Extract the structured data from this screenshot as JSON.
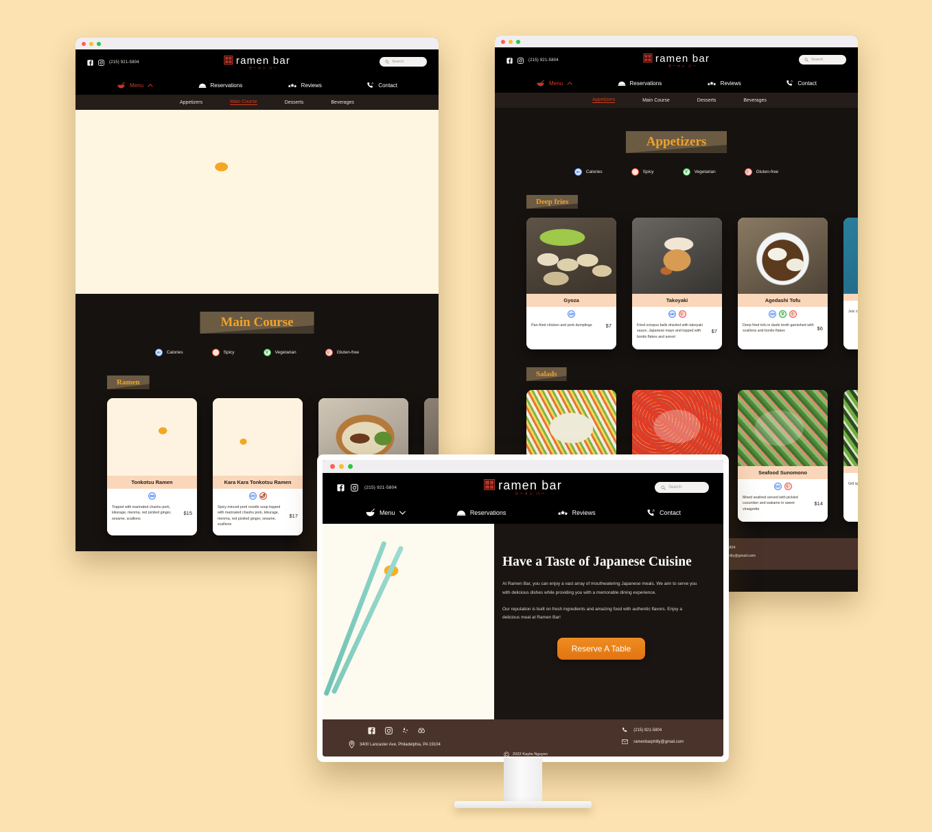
{
  "brand": {
    "name": "ramen bar",
    "kana": "ラーメン バー",
    "phone": "(215) 921-5804",
    "email": "ramenbarphilly@gmail.com",
    "address": "3400 Lancaster Ave, Philadelphia, PA 19104",
    "copyright": "2022 Kaylie Nguyen"
  },
  "colors": {
    "page_background": "#fbe2b0",
    "site_dark": "#000000",
    "body_dark": "#161210",
    "accent_red": "#d93b1d",
    "accent_gold": "#f0a22a",
    "banner_brown": "#6b5b44",
    "card_title_peach": "#fad7bb",
    "footer_brown": "#4a332a",
    "button_orange": "#ef8c21"
  },
  "search": {
    "placeholder": "Search",
    "value": ""
  },
  "nav": [
    {
      "label": "Menu",
      "icon": "ramen-bowl-icon",
      "active": true,
      "caret": "up"
    },
    {
      "label": "Reservations",
      "icon": "cloche-icon",
      "active": false
    },
    {
      "label": "Reviews",
      "icon": "stars-icon",
      "active": false
    },
    {
      "label": "Contact",
      "icon": "phone-ring-icon",
      "active": false
    }
  ],
  "nav_front": [
    {
      "label": "Menu",
      "icon": "ramen-bowl-icon",
      "active": false,
      "caret": "down"
    },
    {
      "label": "Reservations",
      "icon": "cloche-icon",
      "active": false
    },
    {
      "label": "Reviews",
      "icon": "stars-icon",
      "active": false
    },
    {
      "label": "Contact",
      "icon": "phone-ring-icon",
      "active": false
    }
  ],
  "subnav": [
    "Appetizers",
    "Main Course",
    "Desserts",
    "Beverages"
  ],
  "legend": [
    {
      "label": "Calories",
      "badge": "80",
      "kind": "calories"
    },
    {
      "label": "Spicy",
      "badge": "🌶",
      "kind": "spicy"
    },
    {
      "label": "Vegetarian",
      "badge": "V",
      "kind": "vegetarian"
    },
    {
      "label": "Gluten-free",
      "badge": "GF",
      "kind": "gluten-free"
    }
  ],
  "window_main_course": {
    "active_tab": "Main Course",
    "section_title": "Main Course",
    "group_title": "Ramen",
    "items": [
      {
        "name": "Tonkotsu Ramen",
        "calories": "350",
        "tags": [
          "calories"
        ],
        "description": "Topped with marinated chashu pork, kikurage, menma, red pickled ginger, sesame, scallions",
        "price": "$15"
      },
      {
        "name": "Kara Kara Tonkotsu Ramen",
        "calories": "370",
        "tags": [
          "calories",
          "spicy"
        ],
        "description": "Spicy minced pork noodle soup topped with marinated chashu pork, kikurage, menma, red pickled ginger, sesame, scallions",
        "price": "$17"
      },
      {
        "name": "",
        "calories": "",
        "tags": [],
        "description": "",
        "price": ""
      },
      {
        "name": "",
        "calories": "",
        "tags": [],
        "description": "",
        "price": ""
      }
    ]
  },
  "window_appetizers": {
    "active_tab": "Appetizers",
    "section_title": "Appetizers",
    "groups": [
      {
        "group_title": "Deep fries",
        "items": [
          {
            "name": "Gyoza",
            "calories": "120",
            "tags": [
              "calories"
            ],
            "description": "Pan-fried chicken and pork dumplings",
            "price": "$7"
          },
          {
            "name": "Takoyaki",
            "calories": "140",
            "tags": [
              "calories",
              "gluten-free"
            ],
            "description": "Fried octopus balls drizzled with takoyaki sauce, Japanese mayo and topped with bonito flakes and aonori",
            "price": "$7"
          },
          {
            "name": "Agedashi Tofu",
            "calories": "110",
            "tags": [
              "calories",
              "vegetarian",
              "gluten-free"
            ],
            "description": "Deep fried tofu in dashi broth garnished with scallions and bonito flakes",
            "price": "$6"
          },
          {
            "name": "",
            "calories": "",
            "tags": [],
            "description": "Juic chic",
            "price": ""
          }
        ]
      },
      {
        "group_title": "Salads",
        "items": [
          {
            "name": "",
            "calories": "",
            "tags": [],
            "description": "",
            "price": ""
          },
          {
            "name": "",
            "calories": "",
            "tags": [],
            "description": "",
            "price": ""
          },
          {
            "name": "Seafood Sunomono",
            "calories": "110",
            "tags": [
              "calories",
              "gluten-free"
            ],
            "description": "Mixed seafood served with pickled cucumber and wakame in sweet vinaigrette",
            "price": "$14"
          },
          {
            "name": "",
            "calories": "",
            "tags": [],
            "description": "Gril spri cucu",
            "price": ""
          }
        ]
      }
    ]
  },
  "window_home": {
    "hero_title": "Have a Taste of Japanese Cuisine",
    "hero_paragraph_1": "At Ramen Bar, you can enjoy a vast array of mouthwatering Japanese meals. We aim to serve you with delicious dishes while providing you with a memorable dining experience.",
    "hero_paragraph_2": "Our reputation is built on fresh ingredients and amazing food with authentic flavors. Enjoy a delicious meal at Ramen Bar!",
    "cta_label": "Reserve A Table"
  },
  "footer_socials": [
    "facebook-icon",
    "instagram-icon",
    "yelp-icon",
    "tripadvisor-icon"
  ]
}
